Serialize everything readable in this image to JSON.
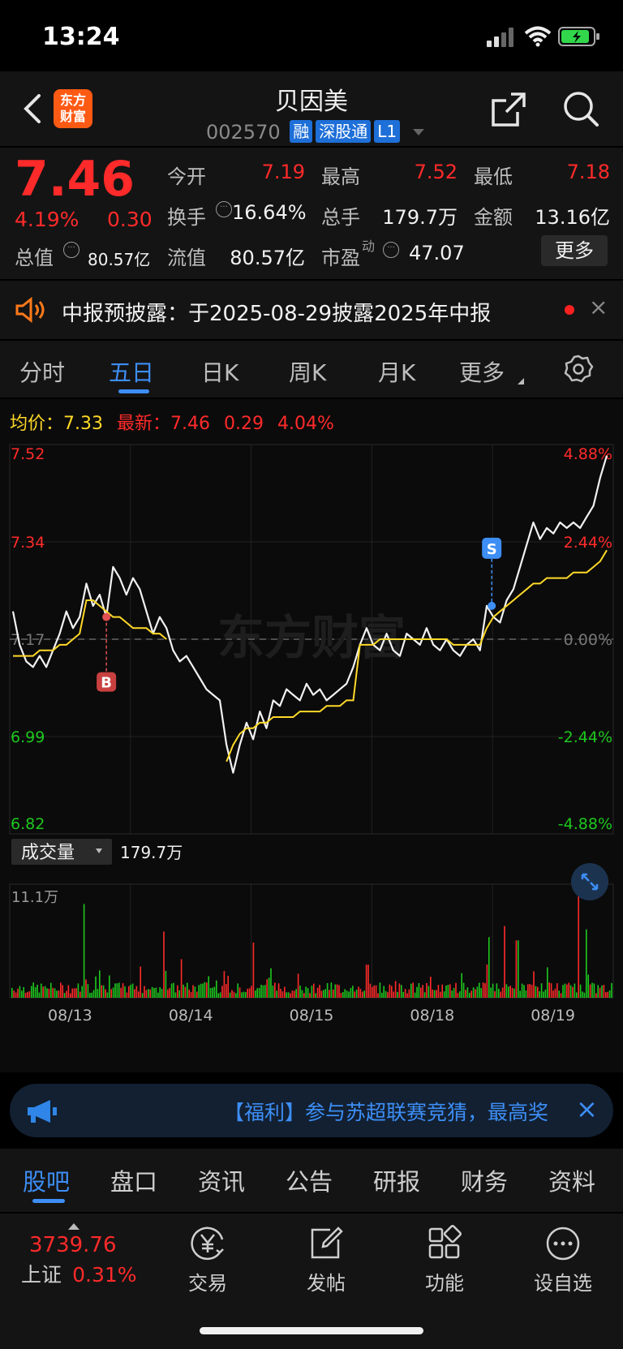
{
  "status": {
    "time": "13:24"
  },
  "header": {
    "name": "贝因美",
    "code": "002570",
    "tags": [
      "融",
      "深股通",
      "L1"
    ],
    "logo_line1": "东方",
    "logo_line2": "财富"
  },
  "quote": {
    "price": "7.46",
    "change_pct": "4.19%",
    "change": "0.30",
    "open_label": "今开",
    "open": "7.19",
    "high_label": "最高",
    "high": "7.52",
    "low_label": "最低",
    "low": "7.18",
    "turnover_label": "换手",
    "turnover": "16.64%",
    "volume_label": "总手",
    "volume": "179.7万",
    "amount_label": "金额",
    "amount": "13.16亿",
    "mktcap_label": "总值",
    "mktcap": "80.57亿",
    "float_label": "流值",
    "float_cap": "80.57亿",
    "pe_label": "市盈",
    "pe_sup": "动",
    "pe": "47.07",
    "more": "更多"
  },
  "notice": {
    "text": "中报预披露：于2025-08-29披露2025年中报"
  },
  "tabs": [
    "分时",
    "五日",
    "日K",
    "周K",
    "月K",
    "更多"
  ],
  "active_tab": 1,
  "chart_info": {
    "avg_label": "均价：",
    "avg": "7.33",
    "latest_label": "最新：",
    "latest": "7.46",
    "chg": "0.29",
    "chg_pct": "4.04%"
  },
  "chart_data": {
    "type": "line",
    "x_labels": [
      "08/13",
      "08/14",
      "08/15",
      "08/18",
      "08/19"
    ],
    "y_left": [
      "7.52",
      "7.34",
      "7.17",
      "6.99",
      "6.82"
    ],
    "y_right": [
      "4.88%",
      "2.44%",
      "0.00%",
      "-2.44%",
      "-4.88%"
    ],
    "ylim": [
      6.82,
      7.52
    ],
    "prev_close": 7.17,
    "price_series": [
      7.22,
      7.16,
      7.13,
      7.12,
      7.14,
      7.12,
      7.15,
      7.18,
      7.22,
      7.19,
      7.21,
      7.27,
      7.23,
      7.25,
      7.21,
      7.3,
      7.28,
      7.25,
      7.28,
      7.26,
      7.22,
      7.18,
      7.21,
      7.19,
      7.15,
      7.13,
      7.14,
      7.12,
      7.1,
      7.08,
      7.07,
      7.06,
      6.98,
      6.93,
      6.98,
      7.02,
      6.99,
      7.04,
      7.01,
      7.06,
      7.05,
      7.08,
      7.07,
      7.06,
      7.09,
      7.07,
      7.08,
      7.06,
      7.07,
      7.08,
      7.09,
      7.12,
      7.16,
      7.19,
      7.16,
      7.15,
      7.18,
      7.15,
      7.14,
      7.18,
      7.17,
      7.16,
      7.19,
      7.16,
      7.15,
      7.17,
      7.15,
      7.14,
      7.16,
      7.17,
      7.15,
      7.23,
      7.21,
      7.2,
      7.24,
      7.26,
      7.3,
      7.34,
      7.38,
      7.35,
      7.37,
      7.36,
      7.38,
      7.37,
      7.38,
      7.37,
      7.39,
      7.41,
      7.46,
      7.5
    ],
    "avg_series": [
      7.14,
      7.14,
      7.14,
      7.14,
      7.15,
      7.15,
      7.15,
      7.16,
      7.16,
      7.17,
      7.18,
      7.24,
      7.24,
      7.23,
      7.22,
      7.21,
      7.21,
      7.2,
      7.19,
      7.19,
      7.19,
      7.18,
      7.18,
      7.17,
      null,
      null,
      null,
      null,
      null,
      null,
      null,
      null,
      6.95,
      6.98,
      7.0,
      7.01,
      7.01,
      7.02,
      7.02,
      7.03,
      7.03,
      7.03,
      7.03,
      7.04,
      7.04,
      7.04,
      7.04,
      7.05,
      7.05,
      7.05,
      7.06,
      7.06,
      7.16,
      7.16,
      7.16,
      7.17,
      7.17,
      7.17,
      7.17,
      7.17,
      7.17,
      7.17,
      7.17,
      7.17,
      7.17,
      7.17,
      7.16,
      7.16,
      7.16,
      7.16,
      7.16,
      7.19,
      7.21,
      7.22,
      7.23,
      7.24,
      7.25,
      7.26,
      7.27,
      7.27,
      7.28,
      7.28,
      7.28,
      7.28,
      7.29,
      7.29,
      7.29,
      7.3,
      7.31,
      7.33
    ],
    "day_boundaries": [
      18,
      32,
      52,
      71
    ],
    "buy_marker": {
      "label": "B",
      "index": 14
    },
    "sell_marker": {
      "label": "S",
      "index": 72
    },
    "watermark": "东方财富",
    "volume_label": "成交量",
    "volume_total": "179.7万",
    "volume_max_label": "11.1万"
  },
  "banner": {
    "text": "【福利】参与苏超联赛竞猜，最高奖"
  },
  "bottom_tabs": [
    "股吧",
    "盘口",
    "资讯",
    "公告",
    "研报",
    "财务",
    "资料"
  ],
  "footer": {
    "index_value": "3739.76",
    "index_name": "上证",
    "index_change": "0.31%",
    "items": [
      "交易",
      "发帖",
      "功能",
      "设自选"
    ]
  }
}
